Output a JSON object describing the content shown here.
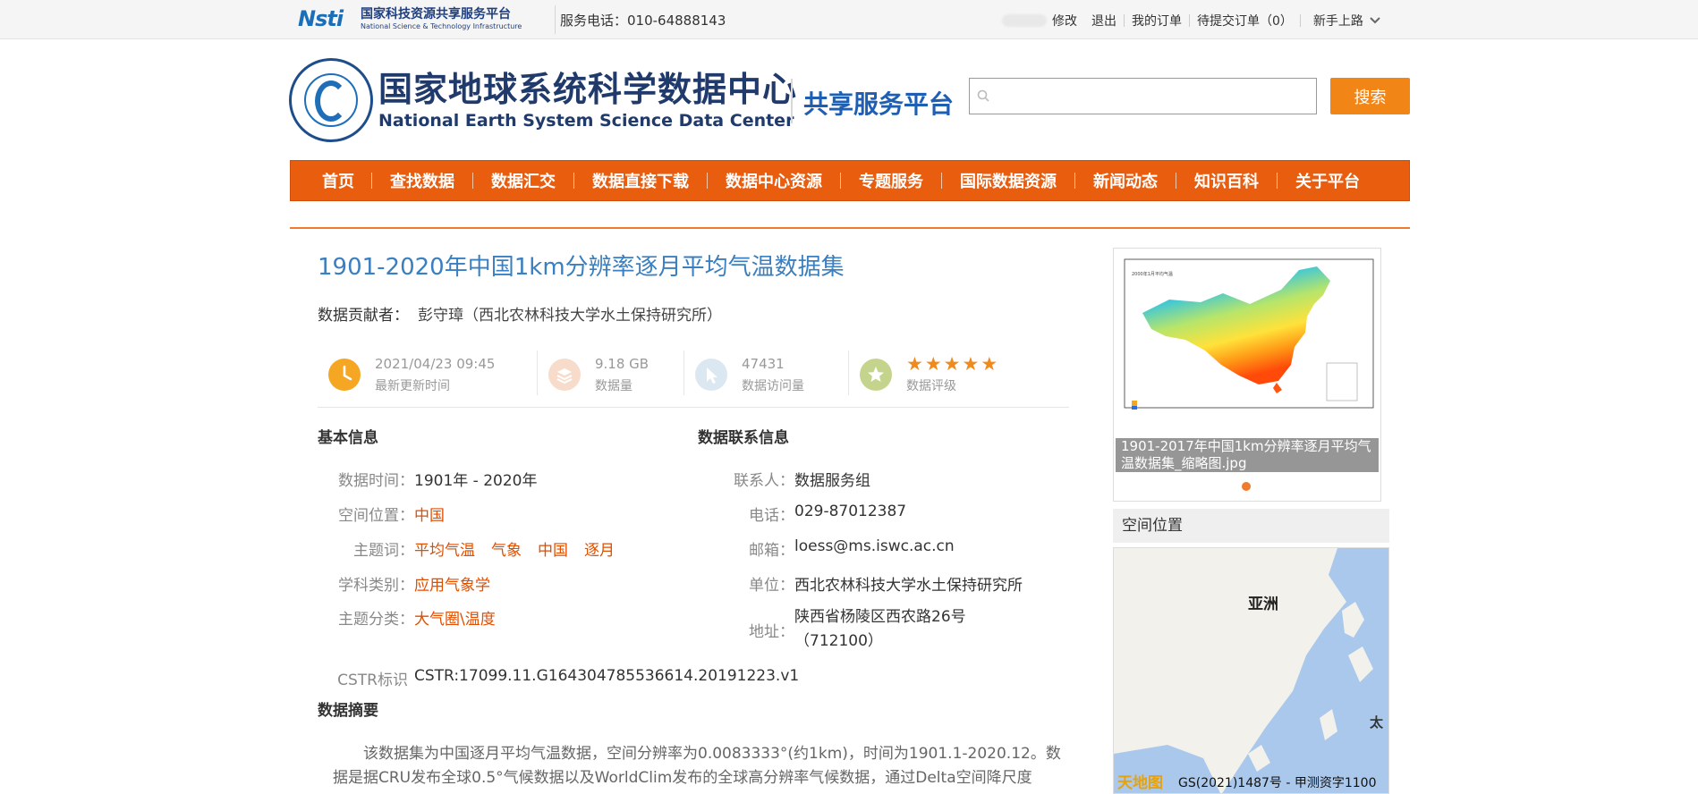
{
  "topbar": {
    "logo_cn": "国家科技资源共享服务平台",
    "logo_en": "National Science & Technology Infrastructure",
    "logo_mark": "Nsti",
    "hotline": "服务电话：010-64888143",
    "links": [
      "修改",
      "退出",
      "我的订单",
      "待提交订单（0）"
    ],
    "newbie": "新手上路"
  },
  "header": {
    "logo_cn": "国家地球系统科学数据中心",
    "logo_en": "National Earth System Science Data Center",
    "platform": "共享服务平台",
    "search_placeholder": "",
    "search_button": "搜索"
  },
  "nav": [
    "首页",
    "查找数据",
    "数据汇交",
    "数据直接下载",
    "数据中心资源",
    "专题服务",
    "国际数据资源",
    "新闻动态",
    "知识百科",
    "关于平台"
  ],
  "dataset": {
    "title": "1901-2020年中国1km分辨率逐月平均气温数据集",
    "contributor_label": "数据贡献者：",
    "contributor": "彭守璋（西北农林科技大学水土保持研究所）",
    "stats": [
      {
        "value": "2021/04/23 09:45",
        "label": "最新更新时间",
        "icon": "clock-icon",
        "color": "#f5a623"
      },
      {
        "value": "9.18 GB",
        "label": "数据量",
        "icon": "layers-icon",
        "color": "#f4c9b0"
      },
      {
        "value": "47431",
        "label": "数据访问量",
        "icon": "cursor-icon",
        "color": "#cfe0ee"
      },
      {
        "value": "",
        "label": "数据评级",
        "icon": "star-badge-icon",
        "color": "#c5d48c",
        "rating": 5
      }
    ],
    "basic": {
      "heading": "基本信息",
      "time_k": "数据时间：",
      "time_v": "1901年 - 2020年",
      "space_k": "空间位置：",
      "space_v": "中国",
      "keywords_k": "主题词：",
      "keywords": [
        "平均气温",
        "气象",
        "中国",
        "逐月"
      ],
      "discipline_k": "学科类别：",
      "discipline_v": "应用气象学",
      "category_k": "主题分类：",
      "category_v": "大气圈\\温度",
      "cstr_k": "CSTR标识",
      "cstr_v": "CSTR:17099.11.G164304785536614.20191223.v1"
    },
    "contact": {
      "heading": "数据联系信息",
      "person_k": "联系人：",
      "person_v": "数据服务组",
      "phone_k": "电话：",
      "phone_v": "029-87012387",
      "email_k": "邮箱：",
      "email_v": "loess@ms.iswc.ac.cn",
      "unit_k": "单位：",
      "unit_v": "西北农林科技大学水土保持研究所",
      "addr_k": "地址：",
      "addr_v": "陕西省杨陵区西农路26号（712100）"
    },
    "abstract_heading": "数据摘要",
    "abstract": "该数据集为中国逐月平均气温数据，空间分辨率为0.0083333°(约1km)，时间为1901.1-2020.12。数据是据CRU发布全球0.5°气候数据以及WorldClim发布的全球高分辨率气候数据，通过Delta空间降尺度"
  },
  "sidebar": {
    "thumb_caption": "1901-2017年中国1km分辨率逐月平均气温数据集_缩略图.jpg",
    "thumb_title": "2000年1月平均气温",
    "spatial_heading": "空间位置",
    "map_label_asia": "亚洲",
    "map_label_tai": "太",
    "map_logo": "天地图",
    "map_credit": "GS(2021)1487号 - 甲测资字1100"
  }
}
